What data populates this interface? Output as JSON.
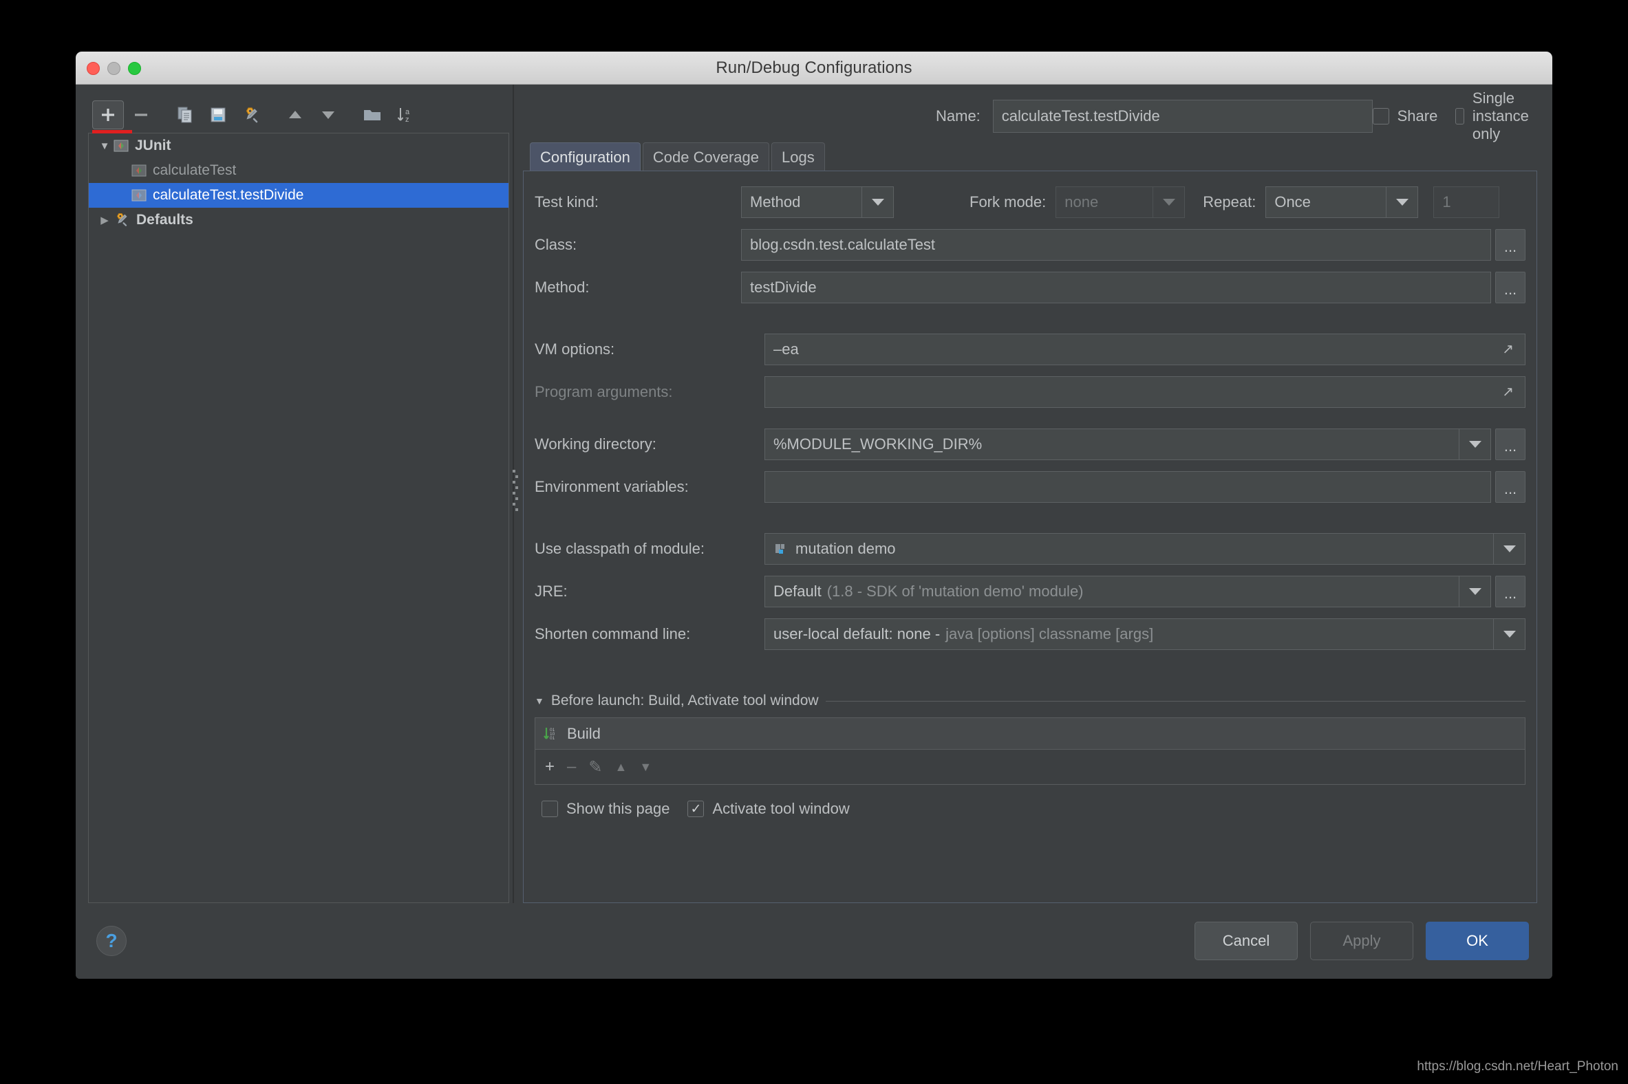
{
  "window": {
    "title": "Run/Debug Configurations"
  },
  "toolbar": {
    "add": "+",
    "remove": "—",
    "copy": "copy-configuration",
    "save": "save-configuration",
    "edit_defaults": "edit-defaults",
    "move_up": "move-up",
    "move_down": "move-down",
    "folder": "create-folder",
    "sort": "sort-alphabetically"
  },
  "tree": {
    "items": [
      {
        "label": "JUnit",
        "level": 0,
        "twisty": "▼",
        "icon": "junit-icon",
        "selected": false,
        "bold": true
      },
      {
        "label": "calculateTest",
        "level": 1,
        "twisty": "",
        "icon": "junit-icon",
        "selected": false,
        "bold": false
      },
      {
        "label": "calculateTest.testDivide",
        "level": 1,
        "twisty": "",
        "icon": "junit-icon",
        "selected": true,
        "bold": false
      },
      {
        "label": "Defaults",
        "level": 0,
        "twisty": "▶",
        "icon": "wrench-icon",
        "selected": false,
        "bold": true
      }
    ]
  },
  "header": {
    "name_label": "Name:",
    "name_value": "calculateTest.testDivide",
    "share_label": "Share",
    "share_checked": false,
    "single_instance_label": "Single instance only",
    "single_instance_checked": false
  },
  "tabs": [
    {
      "label": "Configuration",
      "active": true
    },
    {
      "label": "Code Coverage",
      "active": false
    },
    {
      "label": "Logs",
      "active": false
    }
  ],
  "form": {
    "test_kind_label": "Test kind:",
    "test_kind_value": "Method",
    "fork_mode_label": "Fork mode:",
    "fork_mode_value": "none",
    "repeat_label": "Repeat:",
    "repeat_value": "Once",
    "repeat_count": "1",
    "class_label": "Class:",
    "class_value": "blog.csdn.test.calculateTest",
    "method_label": "Method:",
    "method_value": "testDivide",
    "vm_options_label": "VM options:",
    "vm_options_value": "–ea",
    "program_arguments_label": "Program arguments:",
    "program_arguments_value": "",
    "working_directory_label": "Working directory:",
    "working_directory_value": "%MODULE_WORKING_DIR%",
    "environment_variables_label": "Environment variables:",
    "environment_variables_value": "",
    "module_label": "Use classpath of module:",
    "module_value": "mutation demo",
    "jre_label": "JRE:",
    "jre_value_strong": "Default",
    "jre_value_rest": "(1.8 - SDK of 'mutation demo' module)",
    "shorten_label": "Shorten command line:",
    "shorten_value_strong": "user-local default: none -",
    "shorten_value_rest": "java [options] classname [args]",
    "ellipsis": "..."
  },
  "before_launch": {
    "header": "Before launch: Build, Activate tool window",
    "twisty": "▼",
    "items": [
      {
        "label": "Build",
        "icon": "build-icon"
      }
    ],
    "tools": [
      {
        "name": "add-task-button",
        "glyph": "+",
        "enabled": true
      },
      {
        "name": "remove-task-button",
        "glyph": "–",
        "enabled": false
      },
      {
        "name": "edit-task-button",
        "glyph": "✎",
        "enabled": false
      },
      {
        "name": "move-task-up-button",
        "glyph": "▲",
        "enabled": false
      },
      {
        "name": "move-task-down-button",
        "glyph": "▼",
        "enabled": false
      }
    ],
    "show_page_label": "Show this page",
    "show_page_checked": false,
    "activate_window_label": "Activate tool window",
    "activate_window_checked": true,
    "check_glyph": "✓"
  },
  "footer": {
    "help": "?",
    "cancel": "Cancel",
    "apply": "Apply",
    "ok": "OK"
  },
  "watermark": "https://blog.csdn.net/Heart_Photon",
  "colors": {
    "accent_blue": "#2e6bd4",
    "ok_button": "#36609e",
    "panel_bg": "#3c3f41",
    "field_bg": "#45494a",
    "red_underline": "#e02020"
  }
}
